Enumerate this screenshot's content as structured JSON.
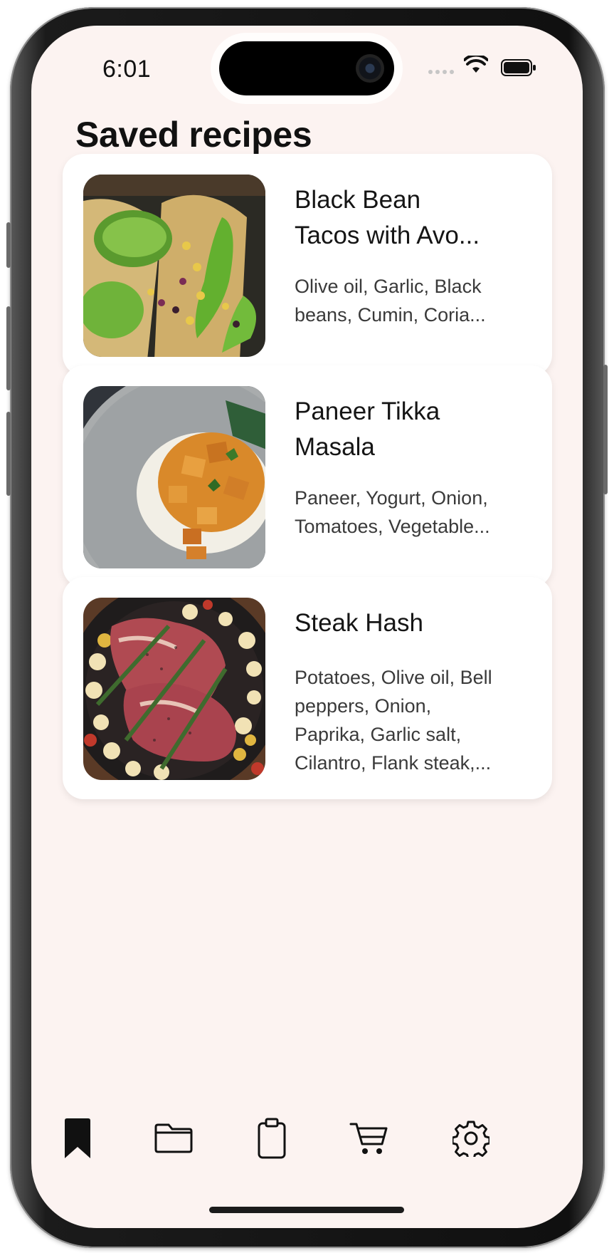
{
  "status_bar": {
    "time": "6:01"
  },
  "header": {
    "title": "Saved recipes"
  },
  "recipes": [
    {
      "title_line1": "Black Bean",
      "title_line2": "Tacos with Avo...",
      "ing_line1": "Olive oil, Garlic, Black",
      "ing_line2": "beans, Cumin, Coria...",
      "image": "tacos-photo"
    },
    {
      "title_line1": "Paneer Tikka",
      "title_line2": "Masala",
      "ing_line1": "Paneer, Yogurt, Onion,",
      "ing_line2": "Tomatoes, Vegetable...",
      "image": "paneer-photo"
    },
    {
      "title_line1": "Steak Hash",
      "title_line2": "",
      "ing_line1": "Potatoes, Olive oil, Bell",
      "ing_line2": "peppers, Onion,",
      "ing_line3": "Paprika, Garlic salt,",
      "ing_line4": "Cilantro, Flank steak,...",
      "image": "steak-photo"
    }
  ],
  "tabbar": {
    "items": [
      "bookmark-icon",
      "folder-icon",
      "clipboard-icon",
      "cart-icon",
      "gear-icon"
    ],
    "active": "bookmark-icon"
  },
  "colors": {
    "background": "#fcf3f1",
    "card": "#ffffff",
    "text": "#151515"
  }
}
